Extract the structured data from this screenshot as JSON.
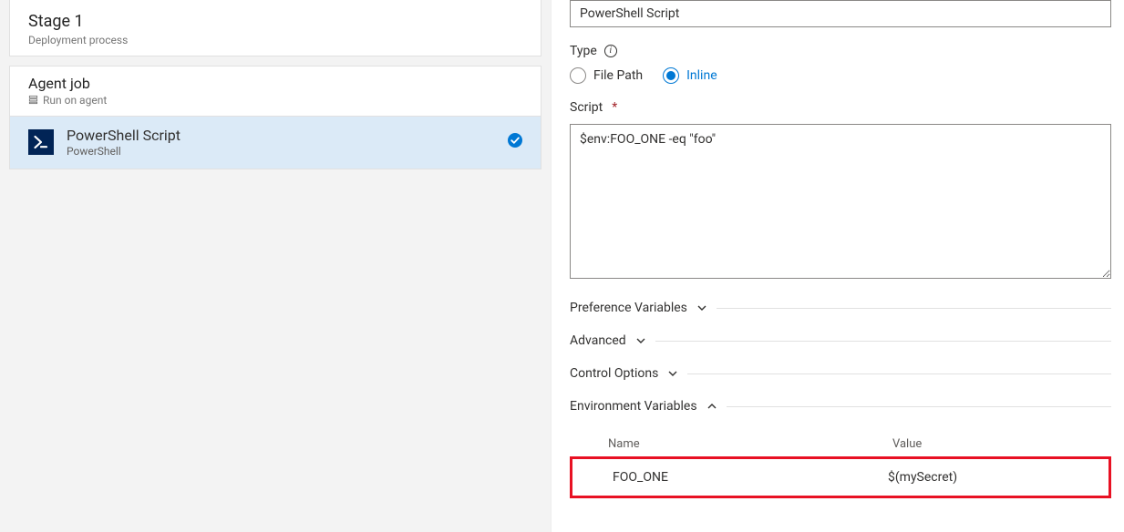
{
  "stage": {
    "title": "Stage 1",
    "subtitle": "Deployment process"
  },
  "agent_job": {
    "title": "Agent job",
    "subtitle": "Run on agent"
  },
  "task": {
    "title": "PowerShell Script",
    "subtitle": "PowerShell"
  },
  "display_name_value": "PowerShell Script",
  "type": {
    "label": "Type",
    "options": {
      "file_path": "File Path",
      "inline": "Inline"
    },
    "selected": "inline"
  },
  "script": {
    "label": "Script",
    "value": "$env:FOO_ONE -eq \"foo\""
  },
  "sections": {
    "preference_variables": {
      "label": "Preference Variables",
      "expanded": false
    },
    "advanced": {
      "label": "Advanced",
      "expanded": false
    },
    "control_options": {
      "label": "Control Options",
      "expanded": false
    },
    "environment_variables": {
      "label": "Environment Variables",
      "expanded": true
    }
  },
  "env_table": {
    "headers": {
      "name": "Name",
      "value": "Value"
    },
    "rows": [
      {
        "name": "FOO_ONE",
        "value": "$(mySecret)"
      }
    ]
  }
}
